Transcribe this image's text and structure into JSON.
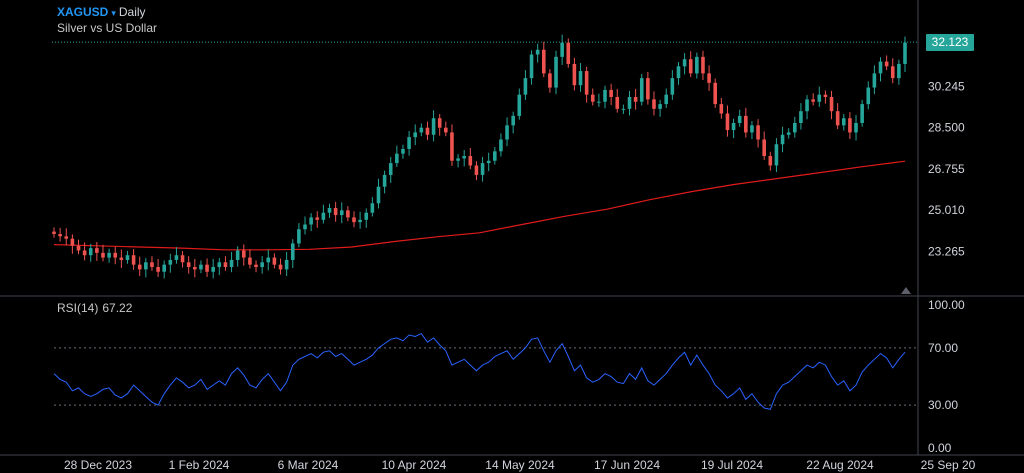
{
  "header": {
    "symbol": "XAGUSD",
    "caret": "▾",
    "interval": "Daily",
    "description": "Silver vs US Dollar"
  },
  "last_price": "32.123",
  "rsi_legend": {
    "label": "RSI(14)",
    "value": "67.22"
  },
  "colors": {
    "background": "#000000",
    "up": "#26a69a",
    "down": "#ef5350",
    "ma": "#e01b1b",
    "rsi": "#2962ff",
    "grid": "#2a2e39",
    "text": "#d1d4dc"
  },
  "chart_data": [
    {
      "type": "candlestick",
      "title": "XAGUSD Daily — Silver vs US Dollar",
      "price_axis_ticks": [
        "32.123",
        "30.245",
        "28.500",
        "26.755",
        "25.010",
        "23.265"
      ],
      "date_axis_ticks": [
        "28 Dec 2023",
        "1 Feb 2024",
        "6 Mar 2024",
        "10 Apr 2024",
        "14 May 2024",
        "17 Jun 2024",
        "19 Jul 2024",
        "22 Aug 2024",
        "25 Sep 20"
      ],
      "ylim": [
        21.5,
        33.4
      ],
      "ohlc_note": "approximate daily closes read from the chart, Dec 2023 – Sep 2024",
      "closes": [
        24.0,
        23.9,
        23.8,
        23.5,
        23.3,
        23.1,
        23.4,
        23.2,
        23.0,
        23.2,
        23.0,
        22.9,
        23.1,
        22.7,
        22.5,
        22.8,
        22.6,
        22.4,
        22.7,
        22.9,
        23.1,
        22.8,
        22.6,
        22.5,
        22.7,
        22.4,
        22.6,
        22.8,
        22.6,
        22.9,
        23.3,
        23.0,
        22.7,
        22.6,
        22.8,
        23.0,
        22.7,
        22.5,
        22.9,
        23.6,
        24.2,
        24.4,
        24.7,
        24.6,
        24.9,
        25.1,
        24.8,
        25.0,
        24.7,
        24.5,
        24.6,
        24.9,
        25.3,
        26.0,
        26.5,
        27.0,
        27.4,
        27.6,
        28.1,
        28.3,
        28.5,
        28.2,
        28.9,
        28.5,
        28.3,
        27.1,
        27.2,
        27.3,
        26.9,
        26.5,
        27.0,
        27.1,
        27.5,
        28.0,
        28.6,
        29.0,
        29.9,
        30.6,
        31.6,
        31.8,
        30.8,
        30.2,
        31.5,
        32.1,
        31.2,
        30.3,
        30.9,
        29.9,
        29.6,
        29.6,
        30.1,
        29.8,
        29.3,
        29.3,
        29.8,
        29.6,
        30.6,
        29.7,
        29.3,
        29.5,
        29.9,
        30.6,
        31.1,
        31.4,
        30.8,
        31.5,
        30.8,
        30.4,
        29.5,
        29.1,
        28.4,
        28.7,
        29.0,
        28.3,
        28.6,
        28.0,
        27.3,
        26.9,
        27.8,
        28.2,
        28.3,
        28.7,
        29.2,
        29.7,
        29.6,
        29.9,
        29.8,
        29.2,
        28.6,
        28.9,
        28.3,
        28.7,
        29.5,
        30.2,
        30.8,
        31.3,
        31.1,
        30.6,
        31.2,
        32.1
      ]
    },
    {
      "type": "line",
      "name": "moving average",
      "values_note": "long-period moving average",
      "x_fraction": [
        0.0,
        0.05,
        0.1,
        0.15,
        0.2,
        0.25,
        0.3,
        0.35,
        0.4,
        0.45,
        0.5,
        0.55,
        0.6,
        0.65,
        0.7,
        0.75,
        0.8,
        0.85,
        0.9,
        0.95,
        1.0
      ],
      "values": [
        23.55,
        23.5,
        23.45,
        23.4,
        23.33,
        23.33,
        23.35,
        23.45,
        23.68,
        23.88,
        24.05,
        24.4,
        24.75,
        25.05,
        25.45,
        25.8,
        26.1,
        26.35,
        26.6,
        26.85,
        27.08
      ]
    },
    {
      "type": "line",
      "title": "RSI(14)",
      "axis_ticks": [
        "100.00",
        "70.00",
        "30.00",
        "0.00"
      ],
      "ylim": [
        0,
        100
      ],
      "levels": [
        70,
        30
      ],
      "values": [
        52,
        48,
        46,
        40,
        42,
        38,
        36,
        38,
        41,
        42,
        37,
        35,
        38,
        44,
        40,
        36,
        32,
        30,
        38,
        44,
        49,
        46,
        42,
        44,
        48,
        41,
        44,
        47,
        44,
        52,
        56,
        51,
        44,
        42,
        48,
        52,
        46,
        40,
        46,
        58,
        62,
        64,
        66,
        63,
        67,
        68,
        64,
        66,
        62,
        58,
        60,
        62,
        65,
        70,
        73,
        76,
        77,
        75,
        79,
        78,
        80,
        74,
        77,
        72,
        68,
        58,
        60,
        62,
        58,
        54,
        58,
        60,
        64,
        66,
        68,
        62,
        66,
        70,
        76,
        77,
        68,
        60,
        68,
        73,
        64,
        54,
        58,
        49,
        46,
        48,
        52,
        50,
        46,
        45,
        52,
        48,
        56,
        47,
        44,
        48,
        52,
        58,
        63,
        67,
        58,
        65,
        58,
        52,
        44,
        40,
        35,
        38,
        42,
        34,
        38,
        32,
        28,
        27,
        38,
        44,
        46,
        50,
        54,
        58,
        56,
        60,
        58,
        50,
        44,
        47,
        40,
        44,
        53,
        58,
        62,
        66,
        63,
        56,
        62,
        67
      ]
    }
  ]
}
